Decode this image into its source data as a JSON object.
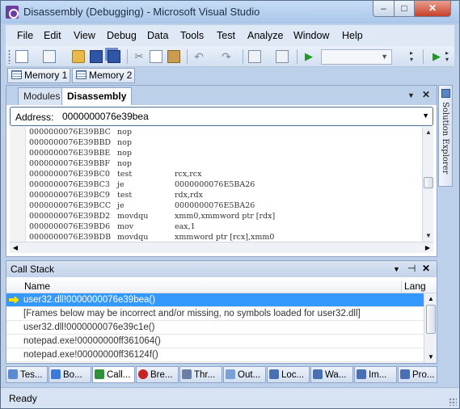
{
  "window": {
    "title": "Disassembly (Debugging) - Microsoft Visual Studio"
  },
  "menu": [
    "File",
    "Edit",
    "View",
    "Debug",
    "Data",
    "Tools",
    "Test",
    "Analyze",
    "Window",
    "Help"
  ],
  "toolbar": {
    "icons": [
      "new-project-icon",
      "add-item-icon",
      "open-icon",
      "save-icon",
      "save-all-icon",
      "cut-icon",
      "copy-icon",
      "paste-icon",
      "undo-icon",
      "redo-icon",
      "navigate-back-icon",
      "navigate-forward-icon",
      "start-icon",
      "start-debugging-icon"
    ],
    "config_combo_value": ""
  },
  "memory_tabs": [
    "Memory 1",
    "Memory 2"
  ],
  "doc_tabs": {
    "inactive": "Modules",
    "active": "Disassembly"
  },
  "address": {
    "label": "Address:",
    "value": "0000000076e39bea"
  },
  "disassembly": [
    {
      "addr": "0000000076E39BBC",
      "mnem": "nop",
      "ops": ""
    },
    {
      "addr": "0000000076E39BBD",
      "mnem": "nop",
      "ops": ""
    },
    {
      "addr": "0000000076E39BBE",
      "mnem": "nop",
      "ops": ""
    },
    {
      "addr": "0000000076E39BBF",
      "mnem": "nop",
      "ops": ""
    },
    {
      "addr": "0000000076E39BC0",
      "mnem": "test",
      "ops": "rcx,rcx"
    },
    {
      "addr": "0000000076E39BC3",
      "mnem": "je",
      "ops": "0000000076E5BA26"
    },
    {
      "addr": "0000000076E39BC9",
      "mnem": "test",
      "ops": "rdx,rdx"
    },
    {
      "addr": "0000000076E39BCC",
      "mnem": "je",
      "ops": "0000000076E5BA26"
    },
    {
      "addr": "0000000076E39BD2",
      "mnem": "movdqu",
      "ops": "xmm0,xmmword ptr [rdx]"
    },
    {
      "addr": "0000000076E39BD6",
      "mnem": "mov",
      "ops": "eax,1"
    },
    {
      "addr": "0000000076E39BDB",
      "mnem": "movdqu",
      "ops": "xmmword ptr [rcx],xmm0"
    }
  ],
  "side_panel": {
    "label": "Solution Explorer"
  },
  "call_stack": {
    "title": "Call Stack",
    "columns": [
      "Name",
      "Lang"
    ],
    "rows": [
      {
        "name": "user32.dll!0000000076e39bea()",
        "current": true
      },
      {
        "name": "[Frames below may be incorrect and/or missing, no symbols loaded for user32.dll]",
        "current": false
      },
      {
        "name": "user32.dll!0000000076e39c1e()",
        "current": false
      },
      {
        "name": "notepad.exe!00000000ff361064()",
        "current": false
      },
      {
        "name": "notepad.exe!00000000ff36124f()",
        "current": false
      }
    ]
  },
  "tool_tabs": [
    {
      "label": "Tes...",
      "icon": "test-results-icon",
      "color": "#5b8ad0"
    },
    {
      "label": "Bo...",
      "icon": "bookmarks-icon",
      "color": "#3d7bd8"
    },
    {
      "label": "Call...",
      "icon": "call-stack-icon",
      "color": "#2f8f3a",
      "active": true
    },
    {
      "label": "Bre...",
      "icon": "breakpoints-icon",
      "color": "#c8231f"
    },
    {
      "label": "Thr...",
      "icon": "threads-icon",
      "color": "#6a7fa8"
    },
    {
      "label": "Out...",
      "icon": "output-icon",
      "color": "#7aa0d8"
    },
    {
      "label": "Loc...",
      "icon": "locals-icon",
      "color": "#4a6fb4"
    },
    {
      "label": "Wa...",
      "icon": "watch-icon",
      "color": "#4a6fb4"
    },
    {
      "label": "Im...",
      "icon": "immediate-icon",
      "color": "#4a6fb4"
    },
    {
      "label": "Pro...",
      "icon": "properties-icon",
      "color": "#4a6fb4"
    }
  ],
  "status": {
    "text": "Ready"
  }
}
